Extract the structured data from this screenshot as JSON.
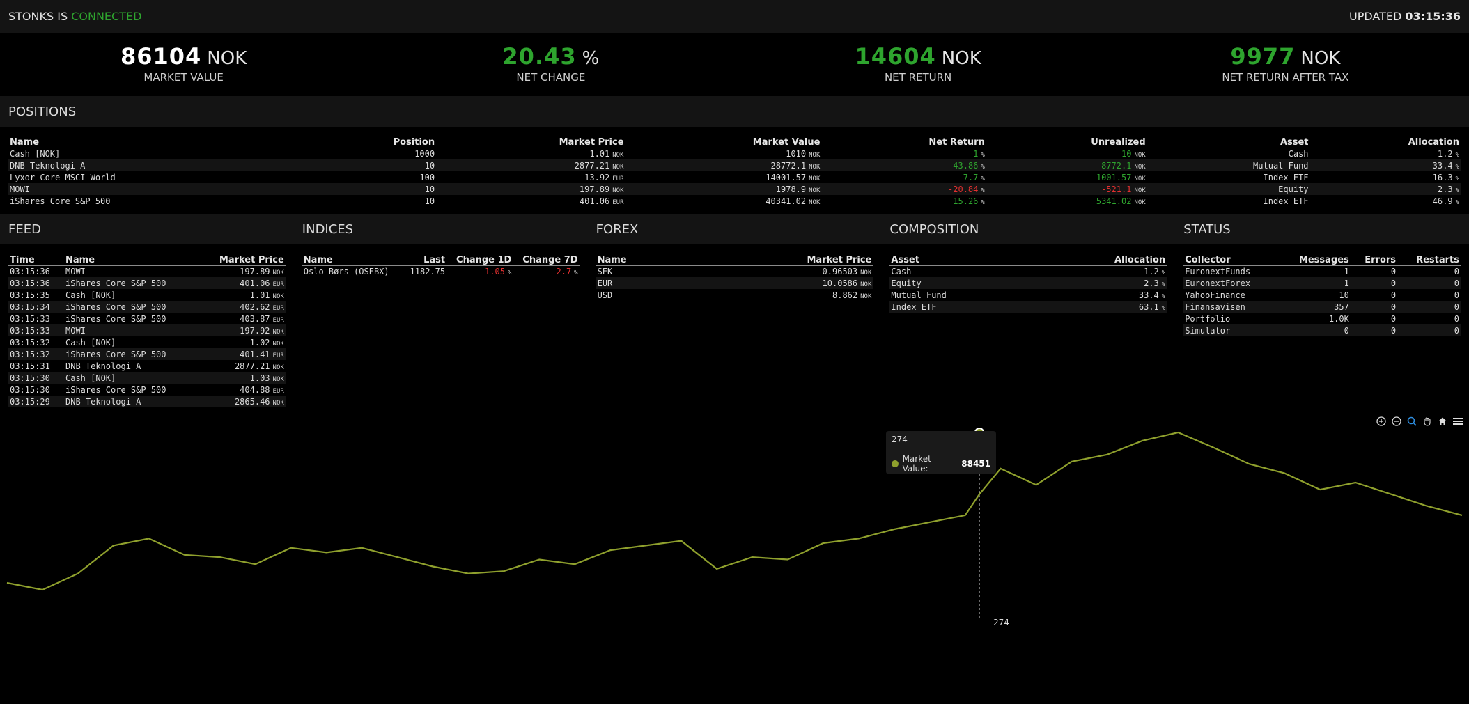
{
  "header": {
    "app_name": "STONKS IS",
    "status": "CONNECTED",
    "updated_label": "UPDATED",
    "updated_time": "03:15:36"
  },
  "kpis": [
    {
      "value": "86104",
      "unit": "NOK",
      "label": "MARKET VALUE",
      "color": "#ffffff"
    },
    {
      "value": "20.43",
      "unit": "%",
      "label": "NET CHANGE",
      "color": "#2ea42e"
    },
    {
      "value": "14604",
      "unit": "NOK",
      "label": "NET RETURN",
      "color": "#2ea42e"
    },
    {
      "value": "9977",
      "unit": "NOK",
      "label": "NET RETURN AFTER TAX",
      "color": "#2ea42e"
    }
  ],
  "positions": {
    "title": "POSITIONS",
    "columns": [
      "Name",
      "Position",
      "Market Price",
      "Market Value",
      "Net Return",
      "Unrealized",
      "Asset",
      "Allocation"
    ],
    "rows": [
      {
        "name": "Cash [NOK]",
        "position": "1000",
        "price": "1.01",
        "price_ccy": "NOK",
        "value": "1010",
        "value_ccy": "NOK",
        "net_return": "1",
        "net_return_color": "green",
        "unrealized": "10",
        "unrealized_color": "green",
        "asset": "Cash",
        "allocation": "1.2"
      },
      {
        "name": "DNB Teknologi A",
        "position": "10",
        "price": "2877.21",
        "price_ccy": "NOK",
        "value": "28772.1",
        "value_ccy": "NOK",
        "net_return": "43.86",
        "net_return_color": "green",
        "unrealized": "8772.1",
        "unrealized_color": "green",
        "asset": "Mutual Fund",
        "allocation": "33.4"
      },
      {
        "name": "Lyxor Core MSCI World",
        "position": "100",
        "price": "13.92",
        "price_ccy": "EUR",
        "value": "14001.57",
        "value_ccy": "NOK",
        "net_return": "7.7",
        "net_return_color": "green",
        "unrealized": "1001.57",
        "unrealized_color": "green",
        "asset": "Index ETF",
        "allocation": "16.3"
      },
      {
        "name": "MOWI",
        "position": "10",
        "price": "197.89",
        "price_ccy": "NOK",
        "value": "1978.9",
        "value_ccy": "NOK",
        "net_return": "-20.84",
        "net_return_color": "red",
        "unrealized": "-521.1",
        "unrealized_color": "red",
        "asset": "Equity",
        "allocation": "2.3"
      },
      {
        "name": "iShares Core S&P 500",
        "position": "10",
        "price": "401.06",
        "price_ccy": "EUR",
        "value": "40341.02",
        "value_ccy": "NOK",
        "net_return": "15.26",
        "net_return_color": "green",
        "unrealized": "5341.02",
        "unrealized_color": "green",
        "asset": "Index ETF",
        "allocation": "46.9"
      }
    ]
  },
  "feed": {
    "title": "FEED",
    "columns": [
      "Time",
      "Name",
      "Market Price"
    ],
    "rows": [
      {
        "time": "03:15:36",
        "name": "MOWI",
        "price": "197.89",
        "ccy": "NOK"
      },
      {
        "time": "03:15:36",
        "name": "iShares Core S&P 500",
        "price": "401.06",
        "ccy": "EUR"
      },
      {
        "time": "03:15:35",
        "name": "Cash [NOK]",
        "price": "1.01",
        "ccy": "NOK"
      },
      {
        "time": "03:15:34",
        "name": "iShares Core S&P 500",
        "price": "402.62",
        "ccy": "EUR"
      },
      {
        "time": "03:15:33",
        "name": "iShares Core S&P 500",
        "price": "403.87",
        "ccy": "EUR"
      },
      {
        "time": "03:15:33",
        "name": "MOWI",
        "price": "197.92",
        "ccy": "NOK"
      },
      {
        "time": "03:15:32",
        "name": "Cash [NOK]",
        "price": "1.02",
        "ccy": "NOK"
      },
      {
        "time": "03:15:32",
        "name": "iShares Core S&P 500",
        "price": "401.41",
        "ccy": "EUR"
      },
      {
        "time": "03:15:31",
        "name": "DNB Teknologi A",
        "price": "2877.21",
        "ccy": "NOK"
      },
      {
        "time": "03:15:30",
        "name": "Cash [NOK]",
        "price": "1.03",
        "ccy": "NOK"
      },
      {
        "time": "03:15:30",
        "name": "iShares Core S&P 500",
        "price": "404.88",
        "ccy": "EUR"
      },
      {
        "time": "03:15:29",
        "name": "DNB Teknologi A",
        "price": "2865.46",
        "ccy": "NOK"
      }
    ]
  },
  "indices": {
    "title": "INDICES",
    "columns": [
      "Name",
      "Last",
      "Change 1D",
      "Change 7D"
    ],
    "rows": [
      {
        "name": "Oslo Børs (OSEBX)",
        "last": "1182.75",
        "change_1d": "-1.05",
        "change_7d": "-2.7"
      }
    ]
  },
  "forex": {
    "title": "FOREX",
    "columns": [
      "Name",
      "Market Price"
    ],
    "rows": [
      {
        "name": "SEK",
        "price": "0.96503",
        "ccy": "NOK"
      },
      {
        "name": "EUR",
        "price": "10.0586",
        "ccy": "NOK"
      },
      {
        "name": "USD",
        "price": "8.862",
        "ccy": "NOK"
      }
    ]
  },
  "composition": {
    "title": "COMPOSITION",
    "columns": [
      "Asset",
      "Allocation"
    ],
    "rows": [
      {
        "asset": "Cash",
        "allocation": "1.2"
      },
      {
        "asset": "Equity",
        "allocation": "2.3"
      },
      {
        "asset": "Mutual Fund",
        "allocation": "33.4"
      },
      {
        "asset": "Index ETF",
        "allocation": "63.1"
      }
    ]
  },
  "status": {
    "title": "STATUS",
    "columns": [
      "Collector",
      "Messages",
      "Errors",
      "Restarts"
    ],
    "rows": [
      {
        "collector": "EuronextFunds",
        "messages": "1",
        "errors": "0",
        "restarts": "0"
      },
      {
        "collector": "EuronextForex",
        "messages": "1",
        "errors": "0",
        "restarts": "0"
      },
      {
        "collector": "YahooFinance",
        "messages": "10",
        "errors": "0",
        "restarts": "0"
      },
      {
        "collector": "Finansavisen",
        "messages": "357",
        "errors": "0",
        "restarts": "0"
      },
      {
        "collector": "Portfolio",
        "messages": "1.0K",
        "errors": "0",
        "restarts": "0"
      },
      {
        "collector": "Simulator",
        "messages": "0",
        "errors": "0",
        "restarts": "0"
      }
    ]
  },
  "tooltip": {
    "x": "274",
    "series_label": "Market Value:",
    "value": "88451"
  },
  "crosshair_label": "274",
  "chart_data": {
    "type": "line",
    "series": [
      {
        "name": "Market Value",
        "color": "#8fa02d",
        "x": [
          0,
          10,
          20,
          30,
          40,
          50,
          60,
          70,
          80,
          90,
          100,
          110,
          120,
          130,
          140,
          150,
          160,
          170,
          180,
          190,
          200,
          210,
          220,
          230,
          240,
          250,
          260,
          270,
          274,
          280,
          290,
          300,
          310,
          320,
          330,
          340,
          350,
          360,
          370,
          380,
          390,
          400,
          410
        ],
        "values": [
          82000,
          81700,
          82400,
          83600,
          83900,
          83200,
          83100,
          82800,
          83500,
          83300,
          83500,
          83100,
          82700,
          82400,
          82500,
          83000,
          82800,
          83400,
          83600,
          83800,
          82600,
          83100,
          83000,
          83700,
          83900,
          84300,
          84600,
          84900,
          85800,
          86900,
          86200,
          87200,
          87500,
          88100,
          88451,
          87800,
          87100,
          86700,
          86000,
          86300,
          85800,
          85300,
          84900
        ]
      }
    ],
    "grid": false,
    "legend": "none"
  }
}
